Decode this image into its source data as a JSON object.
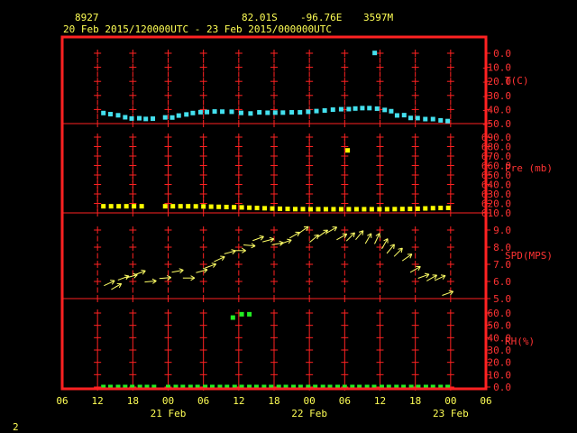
{
  "header": {
    "station": "8927",
    "latitude": "82.01S",
    "longitude": "-96.76E",
    "elevation": "3597M",
    "period": "20 Feb 2015/120000UTC - 23 Feb 2015/000000UTC"
  },
  "footer": {
    "page_number": "2"
  },
  "colors": {
    "frame": "#ff2222",
    "text": "#ffff55",
    "temp": "#44e0ee",
    "pressure": "#ffff00",
    "wind": "#ffff66",
    "rh": "#22ee22"
  },
  "chart_data": {
    "type": "scatter",
    "x_axis": {
      "unit": "hours since 20 Feb 2015 00UTC",
      "range": [
        6,
        78
      ],
      "tick_labels": [
        "06",
        "12",
        "18",
        "00",
        "06",
        "12",
        "18",
        "00",
        "06",
        "12",
        "18",
        "00",
        "06"
      ],
      "date_labels": [
        "21 Feb",
        "22 Feb",
        "23 Feb"
      ]
    },
    "panels": [
      {
        "name": "temperature",
        "label": "T(C)",
        "ylim": [
          -50,
          0
        ],
        "tick_labels": [
          "0.0",
          "-10.0",
          "-20.0",
          "-30.0",
          "-40.0",
          "-50.0"
        ],
        "points": [
          [
            13.0,
            -42.5
          ],
          [
            14.2,
            -43.3
          ],
          [
            15.5,
            -44.1
          ],
          [
            16.7,
            -45.5
          ],
          [
            17.8,
            -46.4
          ],
          [
            19.1,
            -46.2
          ],
          [
            20.2,
            -46.7
          ],
          [
            21.4,
            -46.5
          ],
          [
            23.5,
            -45.6
          ],
          [
            24.7,
            -45.7
          ],
          [
            25.8,
            -44.3
          ],
          [
            27.1,
            -43.5
          ],
          [
            28.2,
            -42.5
          ],
          [
            29.5,
            -41.9
          ],
          [
            30.6,
            -41.8
          ],
          [
            31.9,
            -41.4
          ],
          [
            33.2,
            -41.5
          ],
          [
            34.8,
            -41.6
          ],
          [
            36.4,
            -42.4
          ],
          [
            38.0,
            -42.8
          ],
          [
            39.5,
            -42.0
          ],
          [
            40.9,
            -42.3
          ],
          [
            42.2,
            -42.2
          ],
          [
            43.5,
            -42.2
          ],
          [
            45.0,
            -42.0
          ],
          [
            46.4,
            -42.0
          ],
          [
            47.8,
            -41.6
          ],
          [
            49.2,
            -41.1
          ],
          [
            50.6,
            -40.7
          ],
          [
            52.0,
            -40.1
          ],
          [
            53.4,
            -39.8
          ],
          [
            54.7,
            -39.7
          ],
          [
            55.8,
            -39.3
          ],
          [
            57.0,
            -39.0
          ],
          [
            58.2,
            -39.0
          ],
          [
            59.5,
            -39.4
          ],
          [
            60.8,
            -40.3
          ],
          [
            61.9,
            -41.2
          ],
          [
            62.9,
            -44.2
          ],
          [
            64.1,
            -44.0
          ],
          [
            65.2,
            -46.0
          ],
          [
            66.4,
            -46.1
          ],
          [
            67.7,
            -46.8
          ],
          [
            69.0,
            -46.8
          ],
          [
            70.3,
            -47.7
          ],
          [
            71.5,
            -48.2
          ],
          [
            59.1,
            0.2
          ]
        ]
      },
      {
        "name": "pressure",
        "label": "Pre (mb)",
        "ylim": [
          610,
          690
        ],
        "tick_labels": [
          "690.0",
          "680.0",
          "670.0",
          "660.0",
          "650.0",
          "640.0",
          "630.0",
          "620.0",
          "610.0"
        ],
        "points": [
          [
            13.0,
            617.0
          ],
          [
            14.3,
            617.0
          ],
          [
            15.6,
            617.0
          ],
          [
            16.9,
            617.0
          ],
          [
            18.2,
            617.0
          ],
          [
            19.5,
            617.0
          ],
          [
            23.5,
            617.0
          ],
          [
            24.8,
            617.0
          ],
          [
            26.1,
            617.0
          ],
          [
            27.4,
            617.0
          ],
          [
            28.7,
            616.9
          ],
          [
            30.0,
            616.8
          ],
          [
            31.3,
            616.6
          ],
          [
            32.6,
            616.4
          ],
          [
            33.9,
            616.2
          ],
          [
            35.2,
            616.0
          ],
          [
            36.5,
            615.8
          ],
          [
            37.8,
            615.5
          ],
          [
            39.1,
            615.2
          ],
          [
            40.4,
            614.9
          ],
          [
            41.7,
            614.6
          ],
          [
            43.0,
            614.4
          ],
          [
            44.3,
            614.2
          ],
          [
            45.6,
            614.0
          ],
          [
            46.9,
            614.0
          ],
          [
            48.2,
            613.9
          ],
          [
            49.5,
            613.9
          ],
          [
            50.8,
            613.9
          ],
          [
            52.1,
            613.9
          ],
          [
            53.4,
            613.9
          ],
          [
            54.7,
            613.9
          ],
          [
            56.0,
            613.9
          ],
          [
            57.3,
            613.9
          ],
          [
            58.6,
            613.9
          ],
          [
            59.9,
            613.9
          ],
          [
            61.2,
            613.9
          ],
          [
            62.5,
            614.0
          ],
          [
            63.8,
            614.1
          ],
          [
            65.1,
            614.2
          ],
          [
            66.4,
            614.4
          ],
          [
            67.7,
            614.7
          ],
          [
            69.0,
            615.0
          ],
          [
            70.3,
            615.2
          ],
          [
            71.6,
            615.3
          ],
          [
            54.5,
            676.0
          ]
        ]
      },
      {
        "name": "wind speed",
        "label": "SPD(MPS)",
        "ylim": [
          5,
          9
        ],
        "tick_labels": [
          "9.0",
          "8.0",
          "7.0",
          "6.0",
          "5.0"
        ],
        "points": [
          [
            14.0,
            5.9,
            65
          ],
          [
            15.2,
            5.7,
            60
          ],
          [
            16.4,
            6.2,
            70
          ],
          [
            17.8,
            6.3,
            75
          ],
          [
            19.2,
            6.5,
            70
          ],
          [
            21.0,
            6.0,
            85
          ],
          [
            23.5,
            6.2,
            85
          ],
          [
            25.6,
            6.6,
            80
          ],
          [
            27.5,
            6.2,
            90
          ],
          [
            29.7,
            6.6,
            75
          ],
          [
            31.2,
            6.9,
            70
          ],
          [
            32.7,
            7.3,
            65
          ],
          [
            34.5,
            7.7,
            75
          ],
          [
            36.2,
            7.8,
            90
          ],
          [
            37.8,
            8.1,
            95
          ],
          [
            39.3,
            8.5,
            70
          ],
          [
            41.0,
            8.4,
            75
          ],
          [
            42.6,
            8.2,
            80
          ],
          [
            44.0,
            8.3,
            70
          ],
          [
            45.5,
            8.7,
            60
          ],
          [
            47.0,
            9.0,
            55
          ],
          [
            48.8,
            8.5,
            50
          ],
          [
            50.3,
            8.8,
            55
          ],
          [
            51.8,
            9.0,
            60
          ],
          [
            53.5,
            8.6,
            60
          ],
          [
            55.0,
            8.6,
            45
          ],
          [
            56.5,
            8.7,
            40
          ],
          [
            58.0,
            8.5,
            30
          ],
          [
            59.5,
            8.5,
            25
          ],
          [
            60.8,
            8.2,
            30
          ],
          [
            61.8,
            7.9,
            40
          ],
          [
            63.1,
            7.7,
            45
          ],
          [
            64.6,
            7.4,
            55
          ],
          [
            66.0,
            6.7,
            60
          ],
          [
            67.4,
            6.3,
            70
          ],
          [
            68.8,
            6.2,
            60
          ],
          [
            70.2,
            6.2,
            65
          ],
          [
            71.5,
            5.3,
            70
          ]
        ]
      },
      {
        "name": "relative humidity",
        "label": "RH(%)",
        "ylim": [
          0,
          60
        ],
        "tick_labels": [
          "60.0",
          "50.0",
          "40.0",
          "30.0",
          "20.0",
          "10.0",
          "0.0"
        ],
        "points": [
          [
            13.0,
            0.0
          ],
          [
            14.2,
            0.0
          ],
          [
            15.5,
            0.0
          ],
          [
            16.7,
            0.0
          ],
          [
            17.9,
            0.0
          ],
          [
            19.2,
            0.0
          ],
          [
            20.4,
            0.0
          ],
          [
            21.6,
            0.0
          ],
          [
            24.0,
            0.0
          ],
          [
            25.3,
            0.0
          ],
          [
            26.5,
            0.0
          ],
          [
            27.8,
            0.0
          ],
          [
            29.0,
            0.0
          ],
          [
            30.3,
            0.0
          ],
          [
            31.5,
            0.0
          ],
          [
            32.8,
            0.0
          ],
          [
            34.0,
            0.0
          ],
          [
            35.3,
            0.0
          ],
          [
            36.5,
            0.0
          ],
          [
            37.8,
            0.0
          ],
          [
            39.0,
            0.0
          ],
          [
            40.3,
            0.0
          ],
          [
            41.5,
            0.0
          ],
          [
            42.8,
            0.0
          ],
          [
            44.0,
            0.0
          ],
          [
            45.3,
            0.0
          ],
          [
            46.5,
            0.0
          ],
          [
            47.8,
            0.0
          ],
          [
            49.0,
            0.0
          ],
          [
            50.3,
            0.0
          ],
          [
            51.5,
            0.0
          ],
          [
            52.8,
            0.0
          ],
          [
            54.0,
            0.0
          ],
          [
            55.3,
            0.0
          ],
          [
            56.5,
            0.0
          ],
          [
            57.8,
            0.0
          ],
          [
            59.0,
            0.0
          ],
          [
            60.3,
            0.0
          ],
          [
            61.5,
            0.0
          ],
          [
            62.8,
            0.0
          ],
          [
            64.0,
            0.0
          ],
          [
            65.3,
            0.0
          ],
          [
            66.5,
            0.0
          ],
          [
            67.8,
            0.0
          ],
          [
            69.0,
            0.0
          ],
          [
            70.3,
            0.0
          ],
          [
            71.5,
            0.0
          ],
          [
            35.0,
            56.3
          ],
          [
            36.5,
            59.0
          ],
          [
            37.8,
            59.0
          ]
        ]
      }
    ]
  }
}
